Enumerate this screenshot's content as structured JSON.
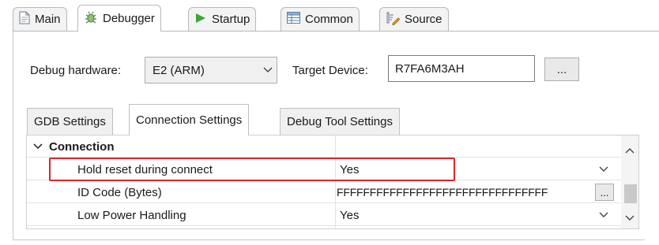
{
  "tabs": [
    {
      "label": "Main",
      "icon": "document-icon"
    },
    {
      "label": "Debugger",
      "icon": "bug-icon"
    },
    {
      "label": "Startup",
      "icon": "run-icon"
    },
    {
      "label": "Common",
      "icon": "table-icon"
    },
    {
      "label": "Source",
      "icon": "source-icon"
    }
  ],
  "debug_hardware": {
    "label": "Debug hardware:",
    "value": "E2 (ARM)"
  },
  "target_device": {
    "label": "Target Device:",
    "value": "R7FA6M3AH",
    "browse_label": "..."
  },
  "inner_tabs": [
    "GDB Settings",
    "Connection Settings",
    "Debug Tool Settings"
  ],
  "table": {
    "group": "Connection",
    "rows": [
      {
        "name": "Hold reset during connect",
        "value": "Yes"
      },
      {
        "name": "ID Code (Bytes)",
        "value": "FFFFFFFFFFFFFFFFFFFFFFFFFFFFFFFF",
        "button": "..."
      },
      {
        "name": "Low Power Handling",
        "value": "Yes"
      }
    ]
  },
  "colors": {
    "highlight": "#d9262c",
    "run_icon": "#3aa838"
  }
}
